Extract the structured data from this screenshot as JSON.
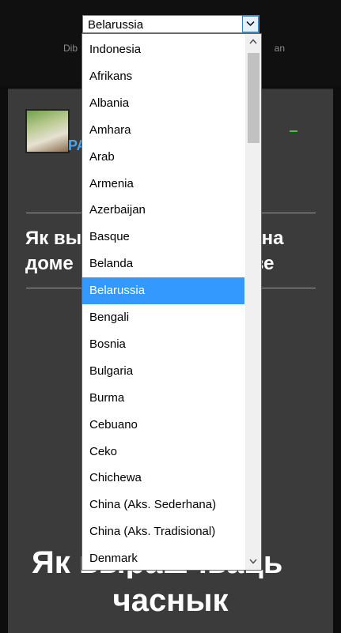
{
  "select": {
    "value": "Belarussia"
  },
  "powered": {
    "left": "Dib",
    "right": "an"
  },
  "brand": {
    "text": "PA"
  },
  "article_title": {
    "line1_left": "Як вы",
    "line1_right": "к на",
    "line2_left": "доме",
    "line2_right": "іве"
  },
  "big_title": {
    "line1": "Як вырашчваць",
    "line2": "часнык"
  },
  "dropdown": {
    "options": [
      "Indonesia",
      "Afrikans",
      "Albania",
      "Amhara",
      "Arab",
      "Armenia",
      "Azerbaijan",
      "Basque",
      "Belanda",
      "Belarussia",
      "Bengali",
      "Bosnia",
      "Bulgaria",
      "Burma",
      "Cebuano",
      "Ceko",
      "Chichewa",
      "China (Aks. Sederhana)",
      "China (Aks. Tradisional)",
      "Denmark"
    ],
    "selected_index": 9
  },
  "colors": {
    "highlight": "#3399ff",
    "brand": "#4aa3e8",
    "panel": "#3b3b3b"
  },
  "icons": {
    "select_arrow": "chevron-down-icon",
    "scroll_up": "triangle-up-icon",
    "scroll_down": "triangle-down-icon"
  }
}
